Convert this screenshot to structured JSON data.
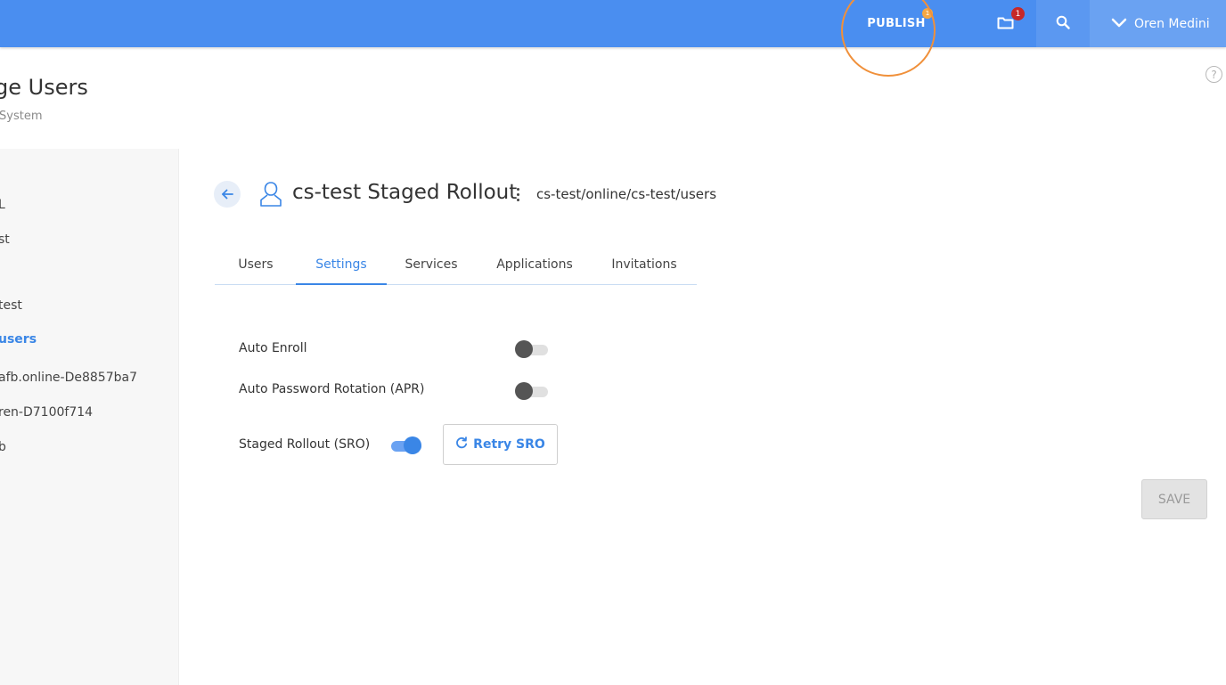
{
  "topbar": {
    "publish_label": "PUBLISH",
    "publish_badge": "1",
    "folder_badge": "1",
    "user_name": "Oren Medini"
  },
  "help_icon_glyph": "?",
  "page": {
    "title": "ge Users",
    "subtitle": "System"
  },
  "sidebar": {
    "items": [
      {
        "label": "L",
        "active": false
      },
      {
        "label": "st",
        "active": false
      },
      {
        "label": "test",
        "active": false
      },
      {
        "label": "users",
        "active": true
      },
      {
        "label": "afb.online-De8857ba7",
        "active": false
      },
      {
        "label": "ren-D7100f714",
        "active": false
      },
      {
        "label": "b",
        "active": false
      }
    ]
  },
  "group": {
    "name": "cs-test Staged Rollout",
    "path": "cs-test/online/cs-test/users"
  },
  "tabs": [
    {
      "label": "Users",
      "active": false
    },
    {
      "label": "Settings",
      "active": true
    },
    {
      "label": "Services",
      "active": false
    },
    {
      "label": "Applications",
      "active": false
    },
    {
      "label": "Invitations",
      "active": false
    }
  ],
  "settings": {
    "auto_enroll": {
      "label": "Auto Enroll",
      "enabled": false
    },
    "apr": {
      "label": "Auto Password Rotation (APR)",
      "enabled": false
    },
    "sro": {
      "label": "Staged Rollout (SRO)",
      "enabled": true
    },
    "retry_label": "Retry SRO"
  },
  "save_label": "SAVE",
  "icons": {
    "back": "arrow-left-icon",
    "group": "user-group-icon",
    "folder": "folder-icon",
    "search": "search-icon",
    "chevron": "chevron-down-icon",
    "retry": "refresh-icon",
    "help": "help-icon"
  },
  "colors": {
    "topbar": "#4a8ef0",
    "accent": "#3a86e6",
    "highlight": "#f0903a",
    "badge": "#c62828"
  }
}
